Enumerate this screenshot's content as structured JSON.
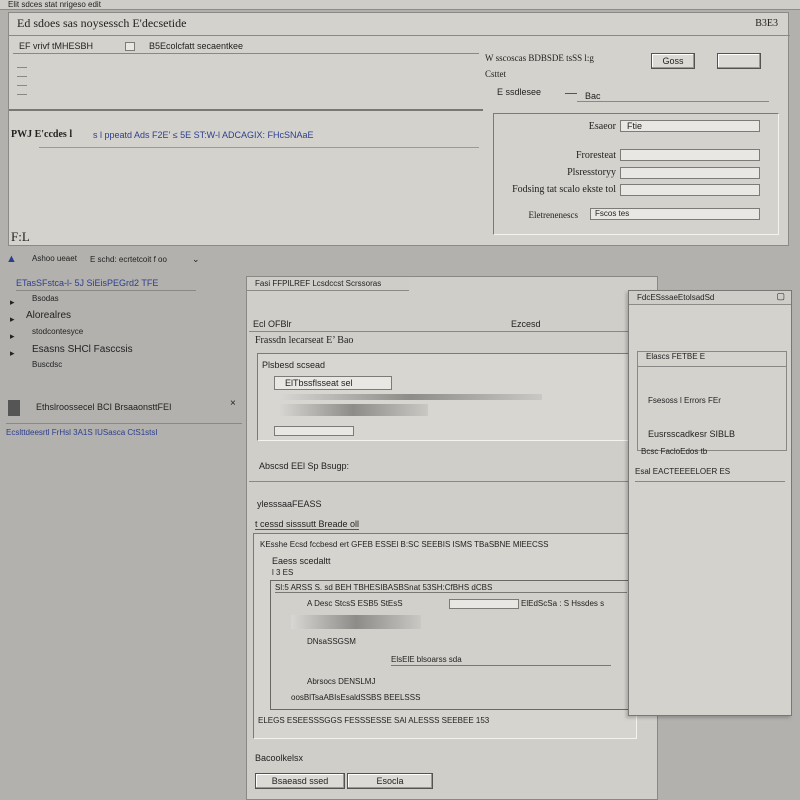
{
  "window": {
    "title": "Ed sdoes sas noysessch E'decsetide",
    "topbar_text": "Elit sdces stat nrigeso edit",
    "top_right_label": "B3E3"
  },
  "top_panel": {
    "row1_text": "EF vrivf tMHESBH",
    "row1_b": "B5Ecolcfatt secaentkee",
    "address_text": "PWJ E'ccdes l",
    "address_tail": "s l ppeatd Ads F2E’ ≤ 5E ST:W-l ADCAGIX: FHcSNAaE",
    "bottom_label": "F:L"
  },
  "right_dialog": {
    "header": "W sscoscas BDBSDE tsSS l:g",
    "sub_label": "Csttet",
    "ok_button": "Goss",
    "cancel_button": "",
    "section_label": "E ssdlesee",
    "section_tab": "Bac",
    "fields": [
      {
        "label": "Esaeor",
        "value": "Ftie"
      },
      {
        "label": "Froresteat",
        "value": ""
      },
      {
        "label": "Plsresstoryy",
        "value": ""
      },
      {
        "label": "Fodsing tat scalo ekste tol",
        "value": ""
      },
      {
        "label": "Eletrenenescs",
        "value": "Fscos tes"
      }
    ]
  },
  "nav_row": {
    "text": "Ashoo ueaet",
    "path": "E schd: ecrtetcoit f oo"
  },
  "sidebar": {
    "items": [
      {
        "label": "ETasSFstca-l- 5J SiEisPEGrd2 TFE"
      },
      {
        "label": "Bsodas"
      },
      {
        "label": "Alorealres"
      },
      {
        "label": "stodcontesyce"
      },
      {
        "label": "Esasns  SHCl Fasccsis"
      },
      {
        "label": "Buscdsc"
      }
    ],
    "section_title": "Ethslroossecel BCI BrsaaonsttFEI",
    "section_link": "Ecslttdeesrtl FrHsl 3A1S IUSasca CtS1stsI"
  },
  "main_panel": {
    "title": "Fasi FFPILREF Lcsdccst Scrssoras",
    "row1": "Ecl OFBlr",
    "row1_right": "Ezcesd",
    "section_header": "Frassdn lecarseat E’ Bao",
    "inner_label": "Plsbesd scsead",
    "inner_field": "ElTbssflsseat sel",
    "footer_link": "Abscsd EEl Sp Bsugp:",
    "group_title": "ylesssaaFEASS",
    "group_sub": "t cessd sisssutt Breade oll",
    "desc_line": "KEsshe Ecsd fccbesd ert GFEB ESSEl B:SC SEEBIS ISMS TBaSBNE MlEECSS",
    "desc_line2": "Eaess scedaltt",
    "desc_line3": "l 3 ES",
    "grid_header": "Sl:5 ARSS S. sd BEH TBHESIBASBSnat 53SH:CfBHS dCBS",
    "grid_rows": [
      "A Desc StcsS ESB5 StEsS",
      "ElEdScSa : S Hssdes s",
      "DNsaSSGSM",
      "ElsElE blsoarss sda",
      "Abrsocs DENSLMJ",
      "oosBlTsaABIsEsaldSSBS BEELSSS"
    ],
    "bottom_row": "ELEGS ESEESSSGGS FESSSESSE SAl ALESSS SEEBEE 153",
    "bottom_label": "Bacoolkelsx",
    "button_1": "Bsaeasd ssed",
    "button_2": "Esocla"
  },
  "right_float": {
    "title": "FdcESssaeEtolsadSd",
    "line1": "Elascs FETBE E",
    "line2": "Fsesoss l Errors FEr",
    "line3": "Eusrsscadkesr SIBLB",
    "line4": "Bcsc FacloEdos tb",
    "line5": "Esal EACTEEEELOER ES"
  }
}
